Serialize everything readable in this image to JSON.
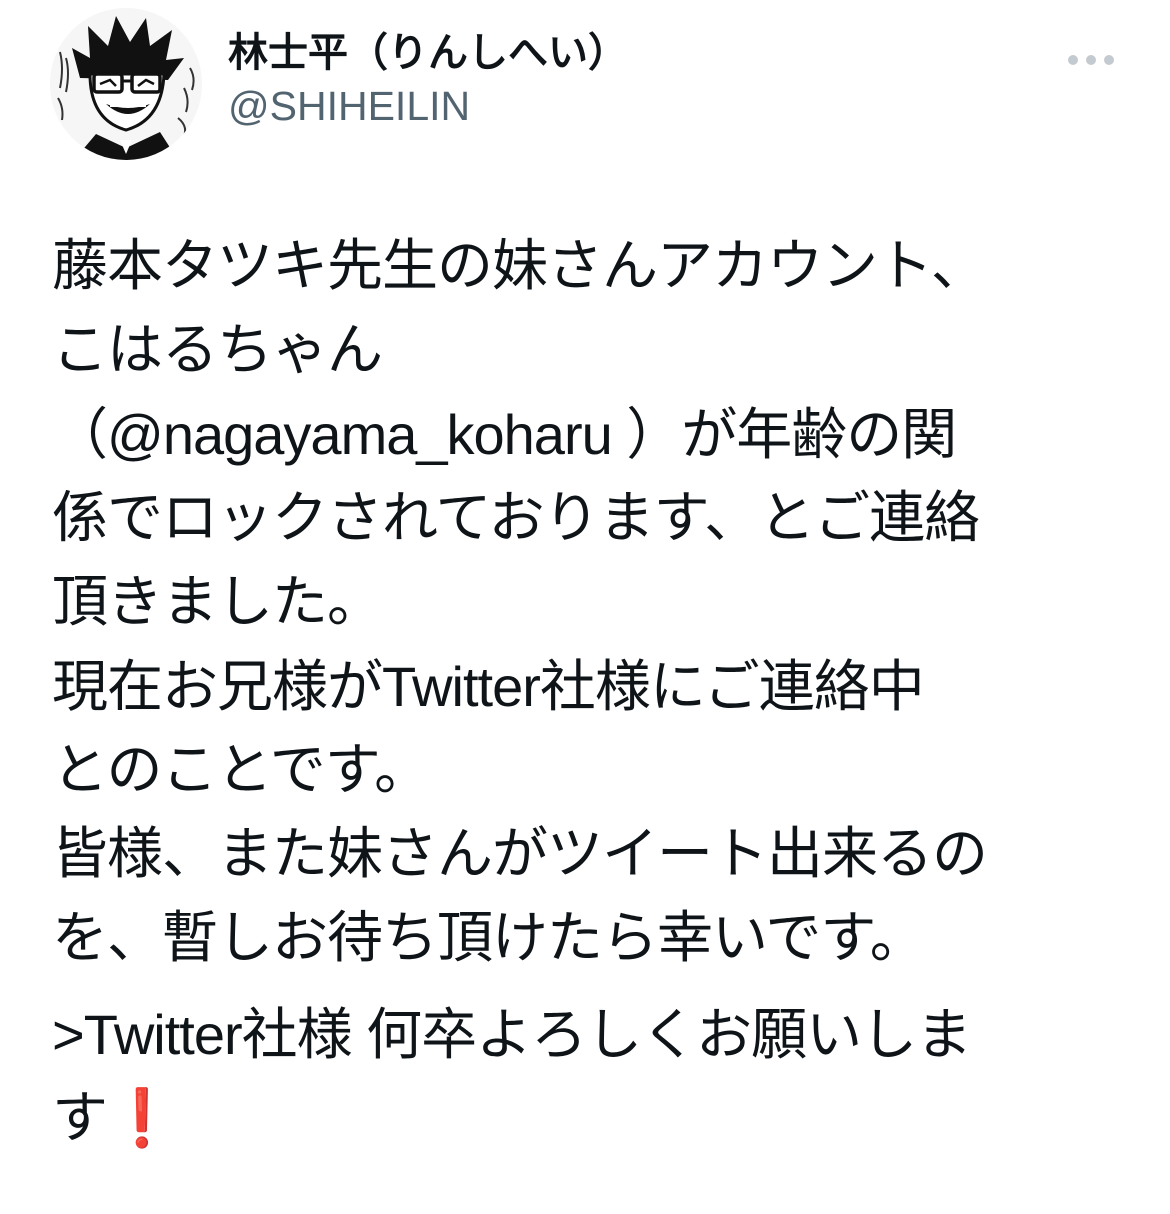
{
  "author": {
    "display_name": "林士平（りんしへい）",
    "handle": "@SHIHEILIN"
  },
  "tweet": {
    "lines": [
      "藤本タツキ先生の妹さんアカウント、",
      "こはるちゃん",
      "（@nagayama_koharu ）が年齢の関",
      "係でロックされております、とご連絡",
      "頂きました。",
      "現在お兄様がTwitter社様にご連絡中",
      "とのことです。",
      "皆様、また妹さんがツイート出来るの",
      "を、暫しお待ち頂けたら幸いです。"
    ],
    "closing_lines": [
      ">Twitter社様 何卒よろしくお願いしま",
      "す"
    ],
    "closing_emoji": "❗"
  },
  "icons": {
    "more": "more-dots-icon",
    "avatar": "manga-character-avatar"
  },
  "colors": {
    "text": "#0f1419",
    "secondary": "#536471",
    "emoji_red": "#e0191b"
  }
}
